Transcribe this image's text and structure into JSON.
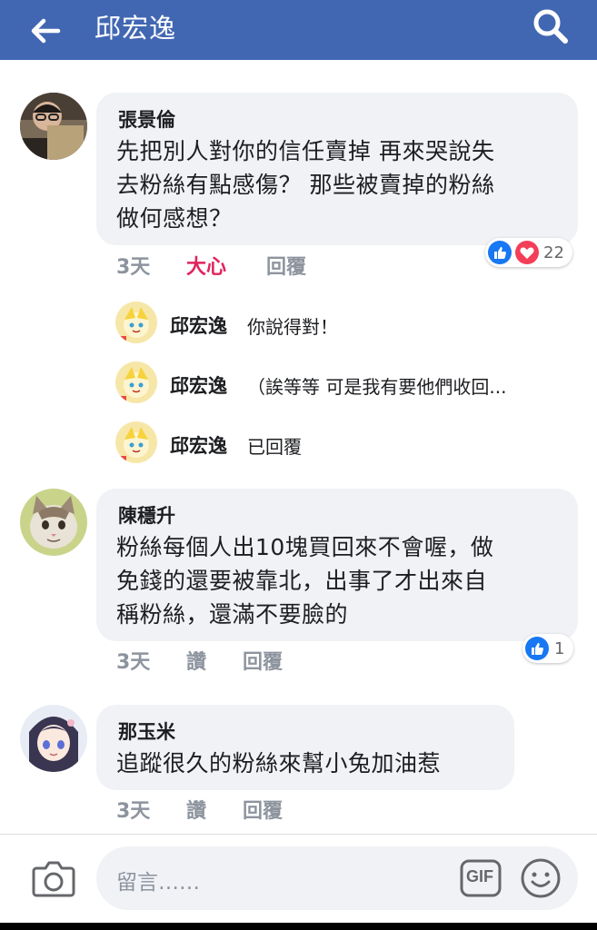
{
  "header": {
    "title": "邱宏逸",
    "back_icon": "arrow-left-icon",
    "search_icon": "search-icon",
    "bg_color": "#4267b2"
  },
  "comments": [
    {
      "author": "張景倫",
      "lines": [
        "先把別人對你的信任賣掉 再來哭說失",
        "去粉絲有點感傷？ 那些被賣掉的粉絲",
        "做何感想？"
      ],
      "time": "3天",
      "like_label": "大心",
      "reply_label": "回覆",
      "reaction_count": "22",
      "reactions": [
        "like-icon",
        "love-icon"
      ],
      "replies": [
        {
          "author": "邱宏逸",
          "text": "你說得對！"
        },
        {
          "author": "邱宏逸",
          "text": "（誒等等 可是我有要他們收回..."
        },
        {
          "author": "邱宏逸",
          "text": "已回覆"
        }
      ]
    },
    {
      "author": "陳穩升",
      "lines": [
        "粉絲每個人出10塊買回來不會喔，做",
        "免錢的還要被靠北，出事了才出來自",
        "稱粉絲，還滿不要臉的"
      ],
      "time": "3天",
      "like_label": "讚",
      "reply_label": "回覆",
      "reaction_count": "1",
      "reactions": [
        "like-icon"
      ]
    },
    {
      "author": "那玉米",
      "lines": [
        "追蹤很久的粉絲來幫小兔加油惹"
      ],
      "time": "3天",
      "like_label": "讚",
      "reply_label": "回覆"
    }
  ],
  "composer": {
    "placeholder": "留言……",
    "camera_icon": "camera-icon",
    "gif_label": "GIF",
    "emoji_icon": "smiley-icon"
  },
  "colors": {
    "brand": "#4267b2",
    "love": "#e0245e",
    "muted": "#8d949e",
    "bubble": "#f0f2f5"
  }
}
